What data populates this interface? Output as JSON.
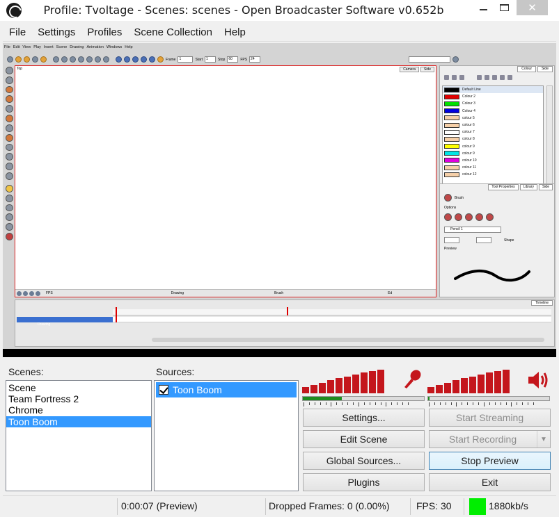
{
  "window": {
    "title": "Profile: Tvoltage - Scenes: scenes - Open Broadcaster Software v0.652b",
    "close_glyph": "✕"
  },
  "menu": [
    "File",
    "Settings",
    "Profiles",
    "Scene Collection",
    "Help"
  ],
  "preview": {
    "app_menu": [
      "File",
      "Edit",
      "View",
      "Play",
      "Insert",
      "Scene",
      "Drawing",
      "Animation",
      "Windows",
      "Help"
    ],
    "toolbar_fields": [
      "Frame",
      "1",
      "Start",
      "1",
      "Stop",
      "60",
      "FPS",
      "24"
    ],
    "camera_tab": "Top",
    "camera_tabs_right": [
      "Camera",
      "Side"
    ],
    "footer_labels": [
      "FPS",
      "Drawing",
      "Brush",
      "Ed"
    ],
    "colour_tabs": [
      "Colour",
      "Side"
    ],
    "palette_header": "Default Line",
    "colours": [
      {
        "label": "Default Line",
        "hex": "#000000"
      },
      {
        "label": "Colour 2",
        "hex": "#e00000"
      },
      {
        "label": "Colour 3",
        "hex": "#00e000"
      },
      {
        "label": "Colour 4",
        "hex": "#0000e0"
      },
      {
        "label": "colour 5",
        "hex": "#f5cfa8"
      },
      {
        "label": "colour 6",
        "hex": "#f5cfa8"
      },
      {
        "label": "colour 7",
        "hex": "#ffffff"
      },
      {
        "label": "colour 8",
        "hex": "#f5cfa8"
      },
      {
        "label": "colour 9",
        "hex": "#ffff00"
      },
      {
        "label": "colour 9",
        "hex": "#00e5e5"
      },
      {
        "label": "colour 10",
        "hex": "#e000e0"
      },
      {
        "label": "colour 11",
        "hex": "#f5cfa8"
      },
      {
        "label": "colour 12",
        "hex": "#f5cfa8"
      }
    ],
    "tool_tabs": [
      "Tool Properties",
      "Library",
      "Side"
    ],
    "tool_name": "Brush",
    "options_label": "Options",
    "brush_preset": "Pencil 1",
    "shape_label": "Shape",
    "preview_label": "Preview",
    "timeline_tab": "Timeline",
    "layer_name": "Drawing"
  },
  "scenes": {
    "label": "Scenes:",
    "items": [
      "Scene",
      "Team Fortress 2",
      "Chrome",
      "Toon Boom"
    ],
    "selected_index": 3
  },
  "sources": {
    "label": "Sources:",
    "items": [
      {
        "name": "Toon Boom",
        "checked": true
      }
    ]
  },
  "audio": {
    "mic_bars": [
      0.25,
      0.35,
      0.45,
      0.55,
      0.65,
      0.72,
      0.8,
      0.88,
      0.95,
      1.0
    ],
    "mic_level": 0.32,
    "desktop_bars": [
      0.25,
      0.35,
      0.45,
      0.55,
      0.65,
      0.72,
      0.8,
      0.88,
      0.95,
      1.0
    ],
    "desktop_level": 0.01,
    "color": "#c4161c",
    "level_color": "#1e8c1e"
  },
  "buttons": {
    "settings": "Settings...",
    "start_streaming": "Start Streaming",
    "edit_scene": "Edit Scene",
    "start_recording": "Start Recording",
    "global_sources": "Global Sources...",
    "stop_preview": "Stop Preview",
    "plugins": "Plugins",
    "exit": "Exit"
  },
  "status": {
    "time": "0:00:07 (Preview)",
    "dropped": "Dropped Frames: 0 (0.00%)",
    "fps": "FPS: 30",
    "bitrate": "1880kb/s",
    "indicator_color": "#00ee00"
  }
}
